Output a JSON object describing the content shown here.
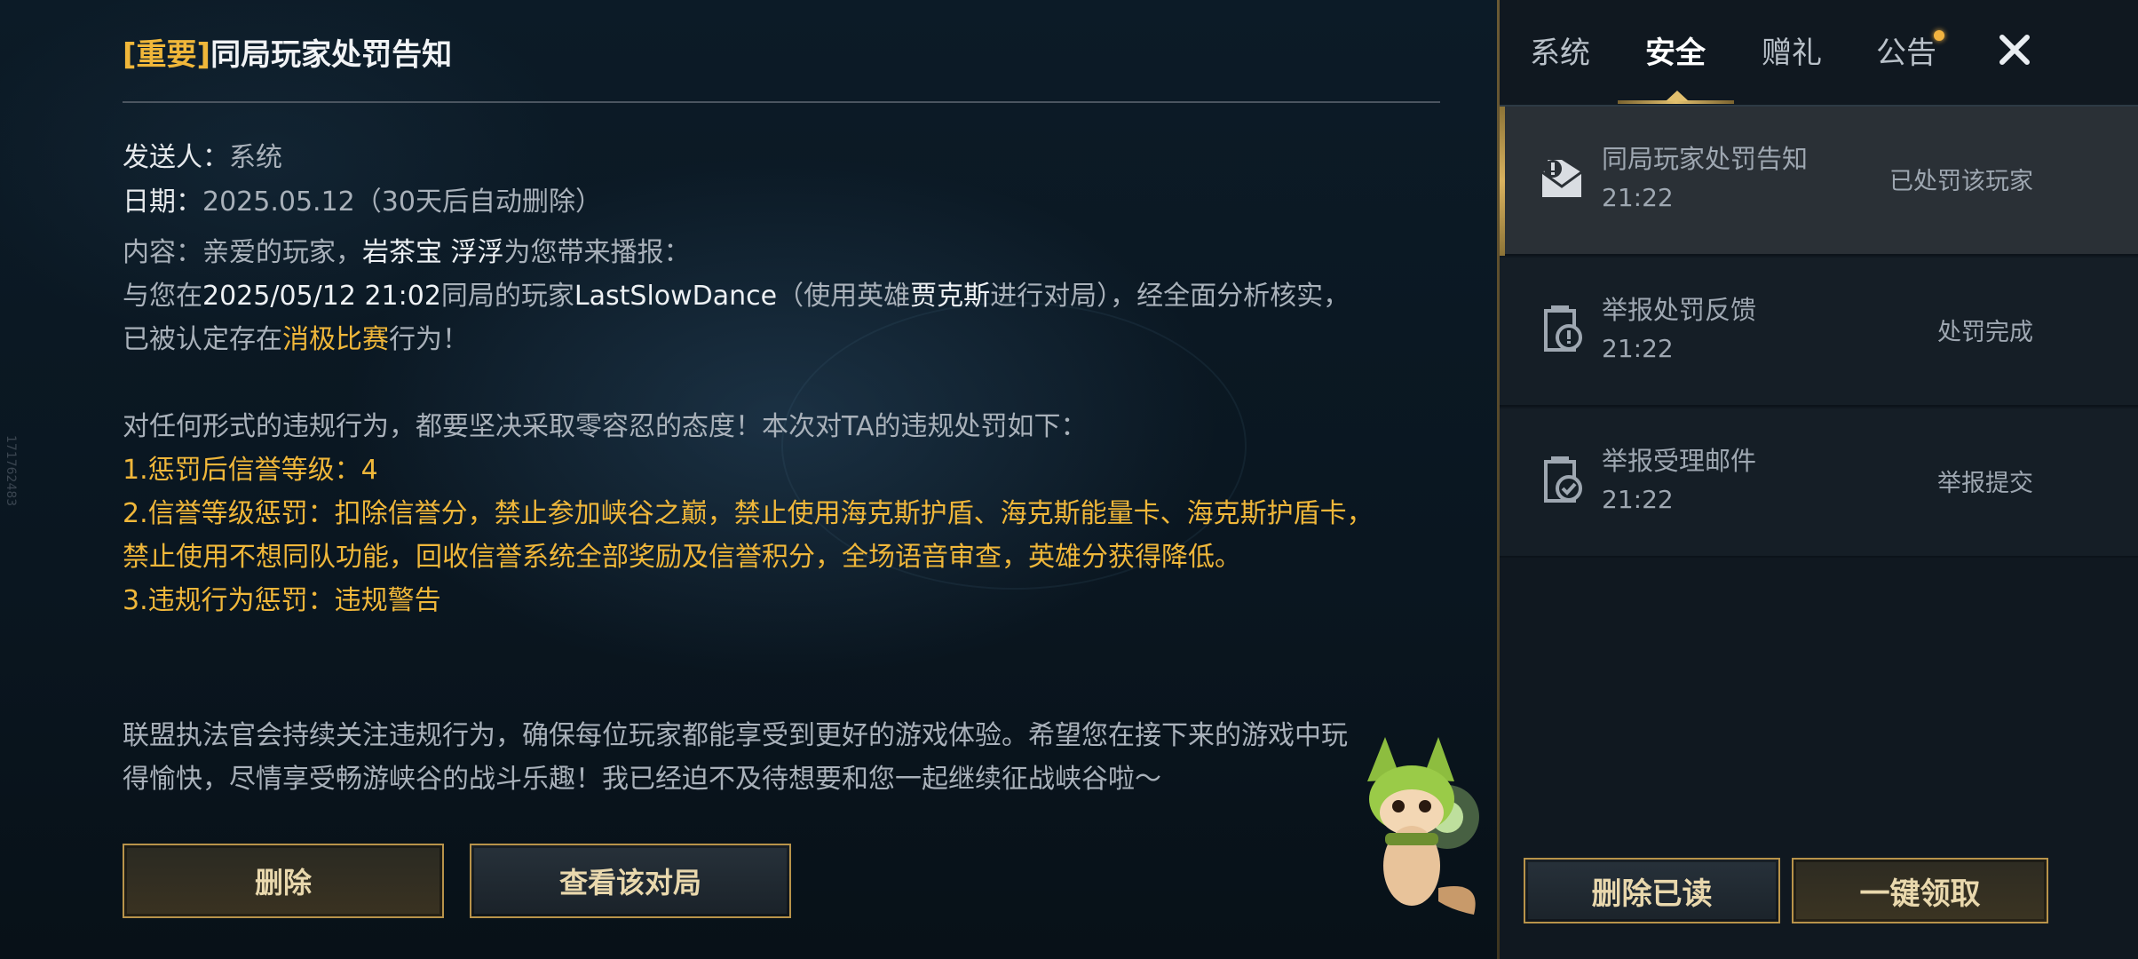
{
  "watermark": "171762483",
  "mail": {
    "title_tag": "[重要]",
    "title": "同局玩家处罚告知",
    "sender_label": "发送人：",
    "sender": "系统",
    "date_label": "日期：",
    "date": "2025.05.12（30天后自动删除）",
    "content_prefix": "内容：亲爱的玩家，",
    "player_name": "岩茶宝 浮浮",
    "content_suffix": "为您带来播报：",
    "line2_a": "与您在",
    "line2_time": "2025/05/12 21:02",
    "line2_b": "同局的玩家",
    "line2_player": "LastSlowDance",
    "line2_c": "（使用英雄",
    "line2_hero": "贾克斯",
    "line2_d": "进行对局），经全面分析核实，",
    "line3_a": "已被认定存在",
    "line3_behavior": "消极比赛",
    "line3_b": "行为！",
    "policy_line": "对任何形式的违规行为，都要坚决采取零容忍的态度！本次对TA的违规处罚如下：",
    "penalty_1": "1.惩罚后信誉等级：4",
    "penalty_2a": "2.信誉等级惩罚：扣除信誉分，禁止参加峡谷之巅，禁止使用海克斯护盾、海克斯能量卡、海克斯护盾卡，",
    "penalty_2b": "禁止使用不想同队功能，回收信誉系统全部奖励及信誉积分，全场语音审查，英雄分获得降低。",
    "penalty_3": "3.违规行为惩罚：违规警告",
    "closing_a": "联盟执法官会持续关注违规行为，确保每位玩家都能享受到更好的游戏体验。希望您在接下来的游戏中玩",
    "closing_b": "得愉快，尽情享受畅游峡谷的战斗乐趣！我已经迫不及待想要和您一起继续征战峡谷啦～",
    "delete_label": "删除",
    "view_match_label": "查看该对局"
  },
  "tabs": [
    {
      "label": "系统",
      "active": false
    },
    {
      "label": "安全",
      "active": true
    },
    {
      "label": "赠礼",
      "active": false
    },
    {
      "label": "公告",
      "active": false,
      "has_dot": true
    }
  ],
  "mail_list": [
    {
      "name": "同局玩家处罚告知",
      "time": "21:22",
      "status": "已处罚该玩家",
      "icon": "mail-alert-icon",
      "selected": true
    },
    {
      "name": "举报处罚反馈",
      "time": "21:22",
      "status": "处罚完成",
      "icon": "report-alert-icon",
      "selected": false
    },
    {
      "name": "举报受理邮件",
      "time": "21:22",
      "status": "举报提交",
      "icon": "report-check-icon",
      "selected": false
    }
  ],
  "actions": {
    "delete_read_label": "删除已读",
    "claim_all_label": "一键领取"
  },
  "colors": {
    "accent_gold": "#f0b73a",
    "button_border": "#b8934a",
    "panel_bg": "#101820"
  }
}
